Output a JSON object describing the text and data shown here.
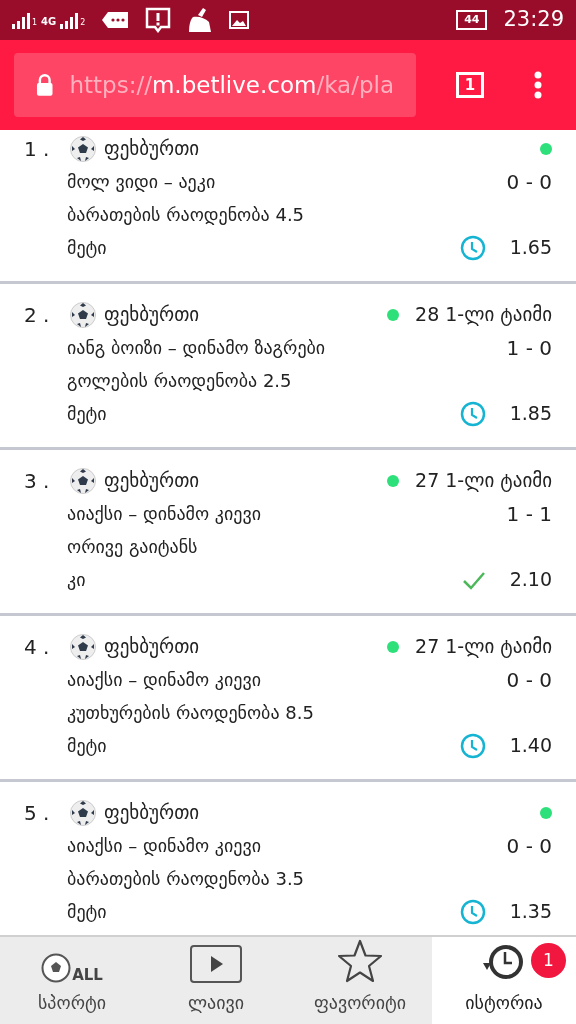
{
  "status_bar": {
    "network": "4G",
    "sim_labels": [
      "1",
      "2"
    ],
    "battery": "44",
    "time": "23:29"
  },
  "browser": {
    "url": {
      "scheme": "https://",
      "host": "m.betlive.com",
      "path": "/ka/pla"
    },
    "tab_count": "1"
  },
  "bets": [
    {
      "number": "1 .",
      "sport": "ფეხბურთი",
      "live": true,
      "teams": "მოლ ვიდი – აეკი",
      "score": "0 - 0",
      "market": "ბარათების რაოდენობა 4.5",
      "selection": "მეტი",
      "won": false,
      "odds": "1.65"
    },
    {
      "number": "2 .",
      "sport": "ფეხბურთი",
      "live": true,
      "match_time": "28 1-ლი ტაიმი",
      "teams": "იანგ ბოიზი – დინამო ზაგრები",
      "score": "1 - 0",
      "market": "გოლების რაოდენობა 2.5",
      "selection": "მეტი",
      "won": false,
      "odds": "1.85"
    },
    {
      "number": "3 .",
      "sport": "ფეხბურთი",
      "live": true,
      "match_time": "27 1-ლი ტაიმი",
      "teams": "აიაქსი – დინამო კიევი",
      "score": "1 - 1",
      "market": "ორივე გაიტანს",
      "selection": "კი",
      "won": true,
      "odds": "2.10"
    },
    {
      "number": "4 .",
      "sport": "ფეხბურთი",
      "live": true,
      "match_time": "27 1-ლი ტაიმი",
      "teams": "აიაქსი – დინამო კიევი",
      "score": "0 - 0",
      "market": "კუთხურების რაოდენობა 8.5",
      "selection": "მეტი",
      "won": false,
      "odds": "1.40"
    },
    {
      "number": "5 .",
      "sport": "ფეხბურთი",
      "live": true,
      "teams": "აიაქსი – დინამო კიევი",
      "score": "0 - 0",
      "market": "ბარათების რაოდენობა 3.5",
      "selection": "მეტი",
      "won": false,
      "odds": "1.35"
    }
  ],
  "bottom_nav": [
    {
      "kind": "sports",
      "label": "სპორტი",
      "icon_text": "ALL",
      "selected": false
    },
    {
      "kind": "live",
      "label": "ლაივი",
      "selected": false
    },
    {
      "kind": "favorites",
      "label": "ფავორიტი",
      "selected": false
    },
    {
      "kind": "history",
      "label": "ისტორია",
      "badge": "1",
      "selected": true
    }
  ]
}
